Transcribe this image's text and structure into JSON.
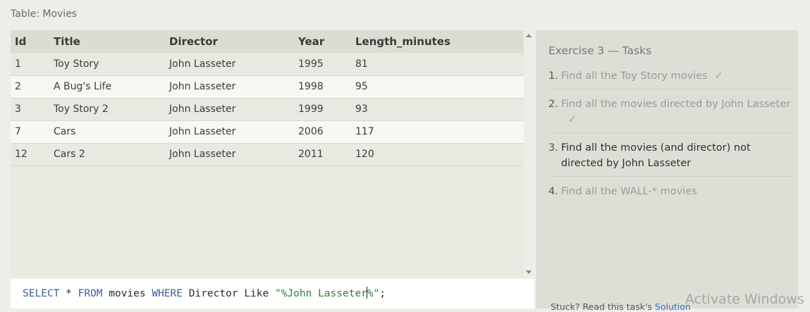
{
  "table_caption": "Table: Movies",
  "table": {
    "columns": [
      "Id",
      "Title",
      "Director",
      "Year",
      "Length_minutes"
    ],
    "rows": [
      [
        "1",
        "Toy Story",
        "John Lasseter",
        "1995",
        "81"
      ],
      [
        "2",
        "A Bug's Life",
        "John Lasseter",
        "1998",
        "95"
      ],
      [
        "3",
        "Toy Story 2",
        "John Lasseter",
        "1999",
        "93"
      ],
      [
        "7",
        "Cars",
        "John Lasseter",
        "2006",
        "117"
      ],
      [
        "12",
        "Cars 2",
        "John Lasseter",
        "2011",
        "120"
      ]
    ]
  },
  "query": {
    "kw_select": "SELECT",
    "star": " * ",
    "kw_from": "FROM",
    "table": " movies ",
    "kw_where": "WHERE",
    "cond": " Director Like ",
    "string_before_caret": "\"%John Lasseter",
    "string_after_caret": "%\"",
    "end": ";"
  },
  "tasks": {
    "title": "Exercise 3 — Tasks",
    "items": [
      {
        "num": "1.",
        "text": "Find all the Toy Story movies",
        "check": "✓"
      },
      {
        "num": "2.",
        "text": "Find all the movies directed by John Lasseter",
        "check": "✓"
      },
      {
        "num": "3.",
        "text": "Find all the movies (and director) not directed by John Lasseter",
        "check": ""
      },
      {
        "num": "4.",
        "text": "Find all the WALL-* movies",
        "check": ""
      }
    ],
    "stuck_text": "Stuck? Read this task's ",
    "solution_link": "Solution"
  },
  "watermark": "Activate Windows",
  "colors": {
    "keyword": "#3b5d9a",
    "string": "#2f7d3a",
    "check": "#6fc27b",
    "link": "#2e6fb8"
  }
}
